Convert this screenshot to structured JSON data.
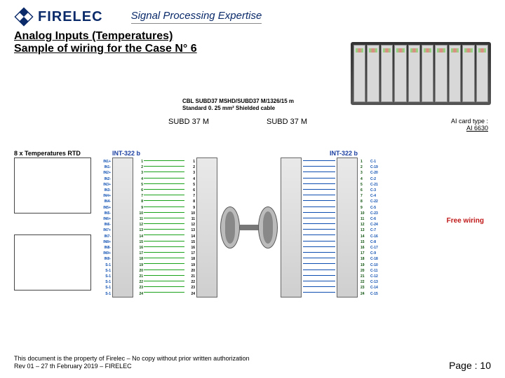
{
  "brand": {
    "name": "FIRELEC",
    "tagline": "Signal Processing Expertise"
  },
  "title": {
    "line1": "Analog Inputs (Temperatures)",
    "line2": "Sample of wiring for the Case N° 6"
  },
  "cable": {
    "ref": "CBL SUBD37 MSHD/SUBD37 M/1326/15 m",
    "spec": "Standard 0. 25 mm² Shielded cable"
  },
  "connectors": {
    "left": "SUBD 37 M",
    "right": "SUBD 37 M"
  },
  "ai_card": {
    "prefix": "AI card type :",
    "model": "AI 6630"
  },
  "labels": {
    "rtd": "8 x Temperatures RTD",
    "int_left": "INT-322 b",
    "int_right": "INT-322 b",
    "free_wiring": "Free wiring"
  },
  "pins_left": {
    "labels": [
      "IN1+",
      "IN1-",
      "IN2+",
      "IN2-",
      "IN3+",
      "IN3-",
      "IN4+",
      "IN4-",
      "IN5+",
      "IN5-",
      "IN6+",
      "IN6-",
      "IN7+",
      "IN7-",
      "IN8+",
      "IN8-",
      "IN9+",
      "IN9-",
      "S-1",
      "S-1",
      "S-1",
      "S-1",
      "S-1",
      "S-1"
    ],
    "nums": [
      "1",
      "2",
      "3",
      "4",
      "5",
      "6",
      "7",
      "8",
      "9",
      "10",
      "11",
      "12",
      "13",
      "14",
      "15",
      "16",
      "17",
      "18",
      "19",
      "20",
      "21",
      "22",
      "23",
      "24"
    ],
    "card_nums": [
      "1",
      "2",
      "3",
      "4",
      "5",
      "6",
      "7",
      "8",
      "9",
      "10",
      "11",
      "12",
      "13",
      "14",
      "15",
      "16",
      "17",
      "18",
      "19",
      "20",
      "21",
      "22",
      "23",
      "24"
    ]
  },
  "pins_right": {
    "nums": [
      "1",
      "2",
      "3",
      "4",
      "5",
      "6",
      "7",
      "8",
      "9",
      "10",
      "11",
      "12",
      "13",
      "14",
      "15",
      "16",
      "17",
      "18",
      "19",
      "20",
      "21",
      "22",
      "23",
      "24"
    ],
    "labels": [
      "C-1",
      "C-19",
      "C-20",
      "C-2",
      "C-21",
      "C-3",
      "C-4",
      "C-22",
      "C-5",
      "C-23",
      "C-6",
      "C-24",
      "C-7",
      "C-16",
      "C-8",
      "C-17",
      "C-9",
      "C-18",
      "C-10",
      "C-11",
      "C-12",
      "C-13",
      "C-14",
      "C-15"
    ]
  },
  "footer": {
    "l1": "This document is the property of Firelec – No copy without prior written authorization",
    "l2": "Rev 01 – 27 th February 2019 – FIRELEC",
    "page": "Page : 10"
  }
}
